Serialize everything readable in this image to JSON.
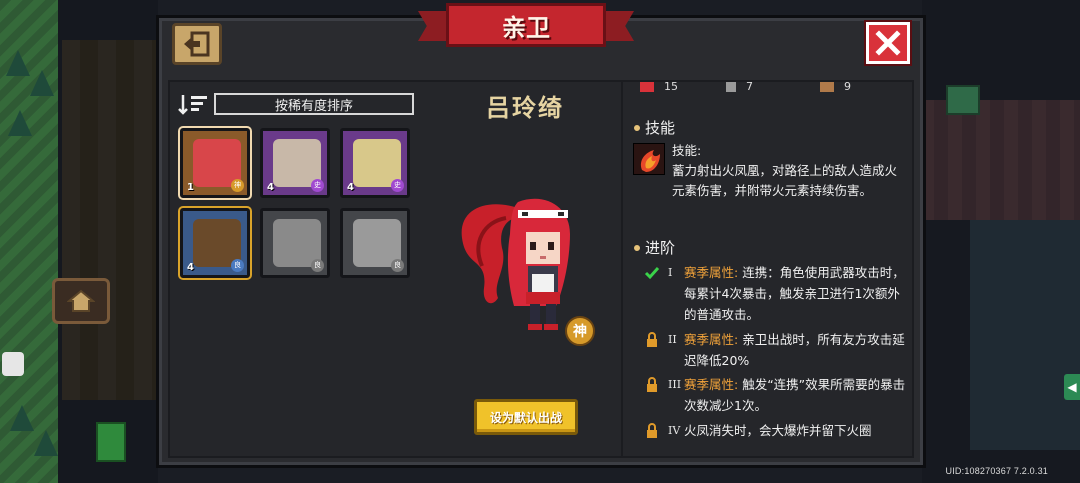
{
  "window": {
    "title": "亲卫",
    "uid": "UID:108270367 7.2.0.31"
  },
  "sort": {
    "label": "按稀有度排序"
  },
  "roster": [
    {
      "level": "1",
      "rank": "神",
      "bg": "#8a5a2a",
      "face": "#d8464a",
      "state": "selected"
    },
    {
      "level": "4",
      "rank": "史",
      "bg": "#6a3a8a",
      "face": "#c8b8a8",
      "state": ""
    },
    {
      "level": "4",
      "rank": "史",
      "bg": "#6a3a8a",
      "face": "#d8c88a",
      "state": ""
    },
    {
      "level": "4",
      "rank": "良",
      "bg": "#3a5a8a",
      "face": "#6a4a2a",
      "state": "picked"
    },
    {
      "level": "",
      "rank": "良",
      "bg": "#44464a",
      "face": "#8a8a8a",
      "state": "locked"
    },
    {
      "level": "",
      "rank": "良",
      "bg": "#44464a",
      "face": "#9a9a9a",
      "state": "locked"
    }
  ],
  "hero": {
    "name": "吕玲绮",
    "rank_badge": "神",
    "deploy_label": "设为默认出战"
  },
  "stats": [
    {
      "icon": "heart-icon",
      "value": "15"
    },
    {
      "icon": "armor-icon",
      "value": "7"
    },
    {
      "icon": "mana-icon",
      "value": "9"
    }
  ],
  "skill": {
    "heading": "技能",
    "text": "技能:\n蓄力射出火凤凰，对路径上的敌人造成火元素伤害，并附带火元素持续伤害。"
  },
  "advance": {
    "heading": "进阶",
    "items": [
      {
        "numeral": "I",
        "status": "unlocked",
        "attr": "赛季属性:",
        "text": "连携：角色使用武器攻击时，每累计4次暴击，触发亲卫进行1次额外的普通攻击。"
      },
      {
        "numeral": "II",
        "status": "locked",
        "attr": "赛季属性:",
        "text": "亲卫出战时，所有友方攻击延迟降低20%"
      },
      {
        "numeral": "III",
        "status": "locked",
        "attr": "赛季属性:",
        "text": "触发“连携”效果所需要的暴击次数减少1次。"
      },
      {
        "numeral": "IV",
        "status": "locked",
        "attr": "",
        "text": "火凤消失时，会大爆炸并留下火圈"
      }
    ]
  },
  "colors": {
    "accent_gold": "#f0c22a",
    "title_red": "#c4262e",
    "attr_orange": "#f0a23a",
    "name_gold": "#e6d4a2"
  }
}
